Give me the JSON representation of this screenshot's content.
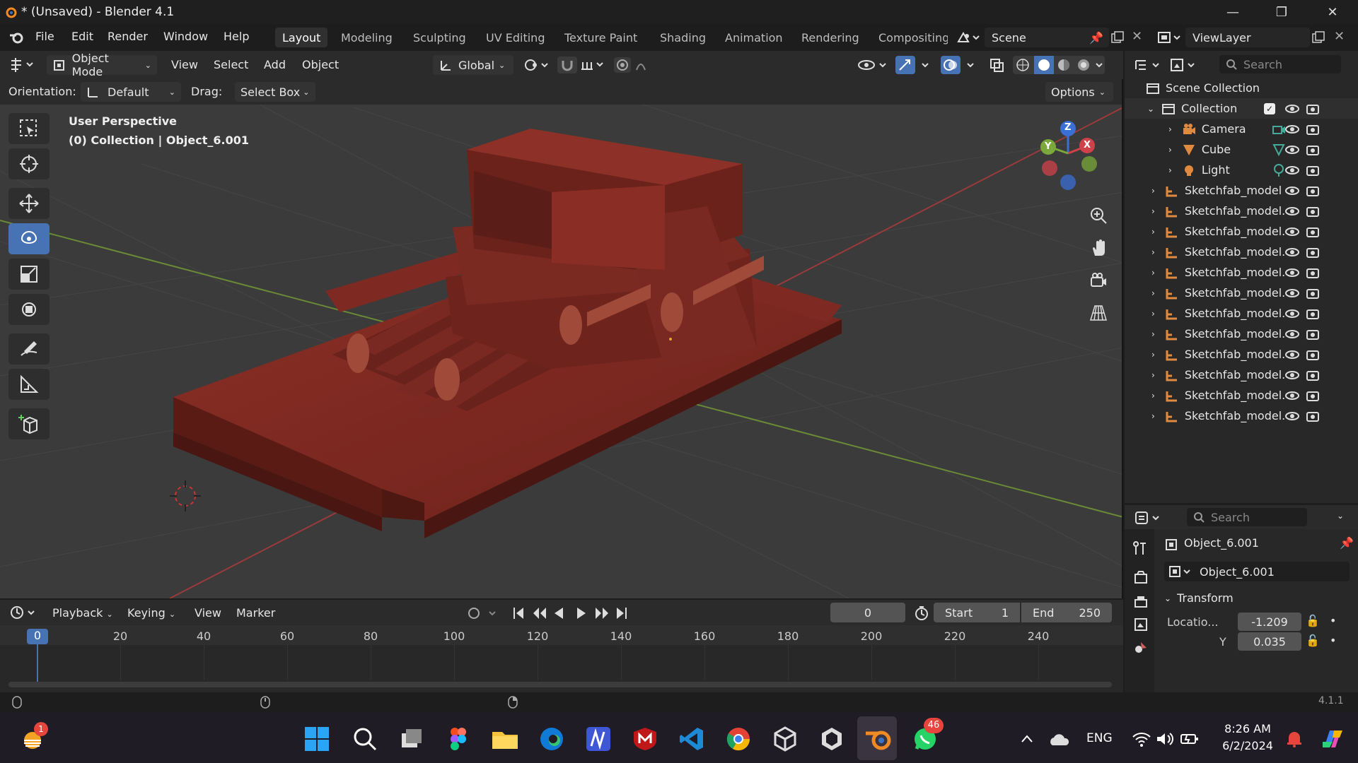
{
  "window": {
    "title": "* (Unsaved) - Blender 4.1"
  },
  "menu": [
    "File",
    "Edit",
    "Render",
    "Window",
    "Help"
  ],
  "workspaces": [
    "Layout",
    "Modeling",
    "Sculpting",
    "UV Editing",
    "Texture Paint",
    "Shading",
    "Animation",
    "Rendering",
    "Compositing"
  ],
  "scene": {
    "label": "Scene"
  },
  "viewlayer": {
    "label": "ViewLayer"
  },
  "viewport_header": {
    "mode": "Object Mode",
    "menus": [
      "View",
      "Select",
      "Add",
      "Object"
    ],
    "orientation_global": "Global",
    "options": "Options"
  },
  "tool_settings": {
    "orientation_label": "Orientation:",
    "orientation_value": "Default",
    "drag_label": "Drag:",
    "drag_value": "Select Box"
  },
  "overlay": {
    "line1": "User Perspective",
    "line2": "(0) Collection | Object_6.001"
  },
  "gizmo": {
    "z": "Z",
    "y": "Y",
    "x": "X"
  },
  "outliner": {
    "search_placeholder": "Search",
    "scene_collection": "Scene Collection",
    "collection": "Collection",
    "children": [
      "Camera",
      "Cube",
      "Light"
    ],
    "models": [
      "Sketchfab_model",
      "Sketchfab_model.",
      "Sketchfab_model.",
      "Sketchfab_model.",
      "Sketchfab_model.",
      "Sketchfab_model.",
      "Sketchfab_model.",
      "Sketchfab_model.",
      "Sketchfab_model.",
      "Sketchfab_model.",
      "Sketchfab_model.",
      "Sketchfab_model."
    ]
  },
  "properties": {
    "search_placeholder": "Search",
    "object_name": "Object_6.001",
    "object_field": "Object_6.001",
    "panel": "Transform",
    "location_label": "Locatio...",
    "location_x": "-1.209",
    "y_label": "Y",
    "location_y": "0.035"
  },
  "timeline": {
    "menus": [
      "Playback",
      "Keying",
      "View",
      "Marker"
    ],
    "current_frame": "0",
    "start_label": "Start",
    "start": "1",
    "end_label": "End",
    "end": "250",
    "ruler": [
      "0",
      "20",
      "40",
      "60",
      "80",
      "100",
      "120",
      "140",
      "160",
      "180",
      "200",
      "220",
      "240"
    ]
  },
  "status": {
    "version": "4.1.1"
  },
  "taskbar": {
    "weather_badge": "1",
    "whatsapp_badge": "46",
    "lang": "ENG",
    "time": "8:26 AM",
    "date": "6/2/2024"
  },
  "colors": {
    "accent": "#4772b3",
    "model": "#7a2a22",
    "grid": "#3a3a3a"
  }
}
